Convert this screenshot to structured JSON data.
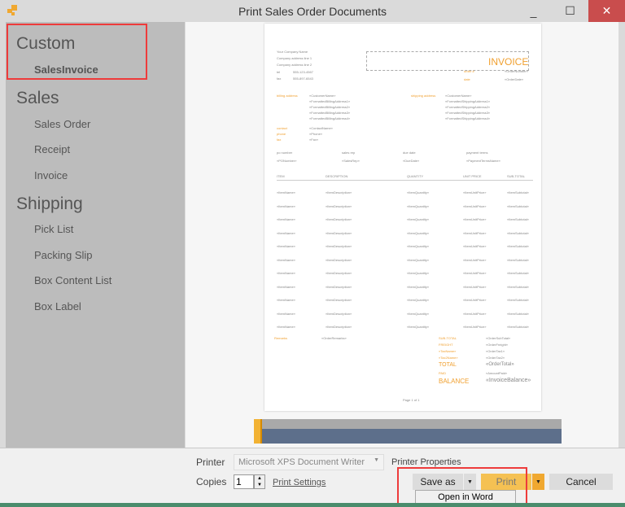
{
  "window": {
    "title": "Print Sales Order Documents",
    "minimize": "_",
    "maximize": "☐",
    "close": "✕"
  },
  "sidebar": {
    "groups": [
      {
        "label": "Custom",
        "items": [
          "SalesInvoice"
        ]
      },
      {
        "label": "Sales",
        "items": [
          "Sales Order",
          "Receipt",
          "Invoice"
        ]
      },
      {
        "label": "Shipping",
        "items": [
          "Pick List",
          "Packing Slip",
          "Box Content List",
          "Box Label"
        ]
      }
    ]
  },
  "document": {
    "company": [
      "Your Company Name",
      "Company address line 1",
      "Company address line 2"
    ],
    "tel_label": "tel",
    "tel": "555-123-4567",
    "fax_label": "fax",
    "fax": "555-897-6543",
    "heading": "INVOICE",
    "order_label": "order #",
    "order_value": "«OrderNumber»",
    "date_label": "date",
    "date_value": "«OrderDate»",
    "billing_label": "billing address",
    "billing": [
      "«CustomerName»",
      "«FormattedBillingAddress1»",
      "«FormattedBillingAddress2»",
      "«FormattedBillingAddress3»",
      "«FormattedBillingAddress4»"
    ],
    "shipping_label": "shipping address",
    "shipping": [
      "«CustomerName»",
      "«FormattedShippingAddress1»",
      "«FormattedShippingAddress2»",
      "«FormattedShippingAddress3»",
      "«FormattedShippingAddress4»"
    ],
    "contact": [
      [
        "contact",
        "«ContactName»"
      ],
      [
        "phone",
        "«Phone»"
      ],
      [
        "fax",
        "«Fax»"
      ]
    ],
    "meta_labels": [
      "po number",
      "sales rep",
      "due date",
      "payment terms"
    ],
    "meta_values": [
      "«PONumber»",
      "«SalesRep»",
      "«DueDate»",
      "«PaymentTermsName»"
    ],
    "columns": [
      "ITEM",
      "DESCRIPTION",
      "QUANTITY",
      "UNIT PRICE",
      "SUB-TOTAL"
    ],
    "row": [
      "«ItemName»",
      "«ItemDescription»",
      "«ItemQuantity»",
      "«ItemUnitPrice»",
      "«ItemSubtotal»"
    ],
    "row_count": 11,
    "remarks_label": "Remarks",
    "remarks_value": "«OrderRemarks»",
    "totals": [
      [
        "SUB-TOTAL",
        "«OrderSubTotal»"
      ],
      [
        "FREIGHT",
        "«OrderFreight»"
      ],
      [
        "«TaxName»",
        "«OrderTax1»"
      ],
      [
        "«Tax2Name»",
        "«OrderTax2»"
      ],
      [
        "TOTAL",
        "«OrderTotal»"
      ],
      [
        "PAID",
        "«AmountPaid»"
      ],
      [
        "BALANCE",
        "«InvoiceBalance»"
      ]
    ],
    "footer": "Page 1 of 1"
  },
  "bottom": {
    "printer_label": "Printer",
    "printer_value": "Microsoft XPS Document Writer",
    "printer_properties": "Printer Properties",
    "copies_label": "Copies",
    "copies_value": "1",
    "print_settings": "Print Settings",
    "save_as": "Save as",
    "print": "Print",
    "cancel": "Cancel",
    "menu_item": "Open in Word"
  },
  "colors": {
    "accent": "#f0a030",
    "close": "#c94d4d",
    "highlight": "#ee3b3b"
  }
}
